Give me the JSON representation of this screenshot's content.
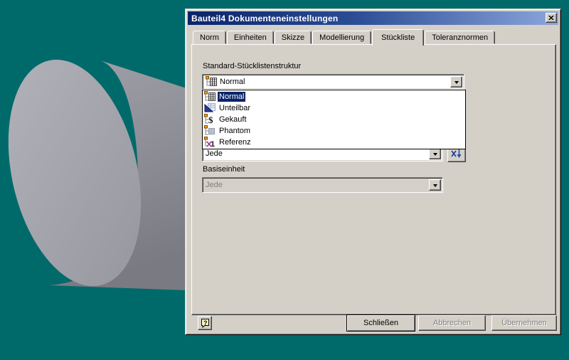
{
  "colors": {
    "desktop": "#006A6A",
    "titlebar_start": "#0A246A",
    "titlebar_end": "#8CA6DC",
    "dialog_face": "#D4D0C8",
    "selection_highlight": "#0A246A",
    "part_gray": "#9C9CA4"
  },
  "scene": {
    "object": "gray-cylinder-part"
  },
  "dialog": {
    "title": "Bauteil4 Dokumenteneinstellungen",
    "tabs": [
      {
        "label": "Norm"
      },
      {
        "label": "Einheiten"
      },
      {
        "label": "Skizze"
      },
      {
        "label": "Modellierung"
      },
      {
        "label": "Stückliste",
        "active": true
      },
      {
        "label": "Toleranznormen"
      }
    ],
    "bom": {
      "label": "Standard-Stücklistenstruktur",
      "value": "Normal",
      "options": [
        {
          "label": "Normal",
          "icon": "bom-normal-icon",
          "selected": true
        },
        {
          "label": "Unteilbar",
          "icon": "bom-inseparable-icon",
          "selected": false
        },
        {
          "label": "Gekauft",
          "icon": "bom-purchased-icon",
          "selected": false
        },
        {
          "label": "Phantom",
          "icon": "bom-phantom-icon",
          "selected": false
        },
        {
          "label": "Referenz",
          "icon": "bom-reference-icon",
          "selected": false
        }
      ]
    },
    "quantity": {
      "value": "Jede"
    },
    "base_unit": {
      "label": "Basiseinheit",
      "value": "Jede",
      "disabled": true
    },
    "footer": {
      "help": "?",
      "close": "Schließen",
      "cancel": "Abbrechen",
      "apply": "Übernehmen"
    }
  }
}
